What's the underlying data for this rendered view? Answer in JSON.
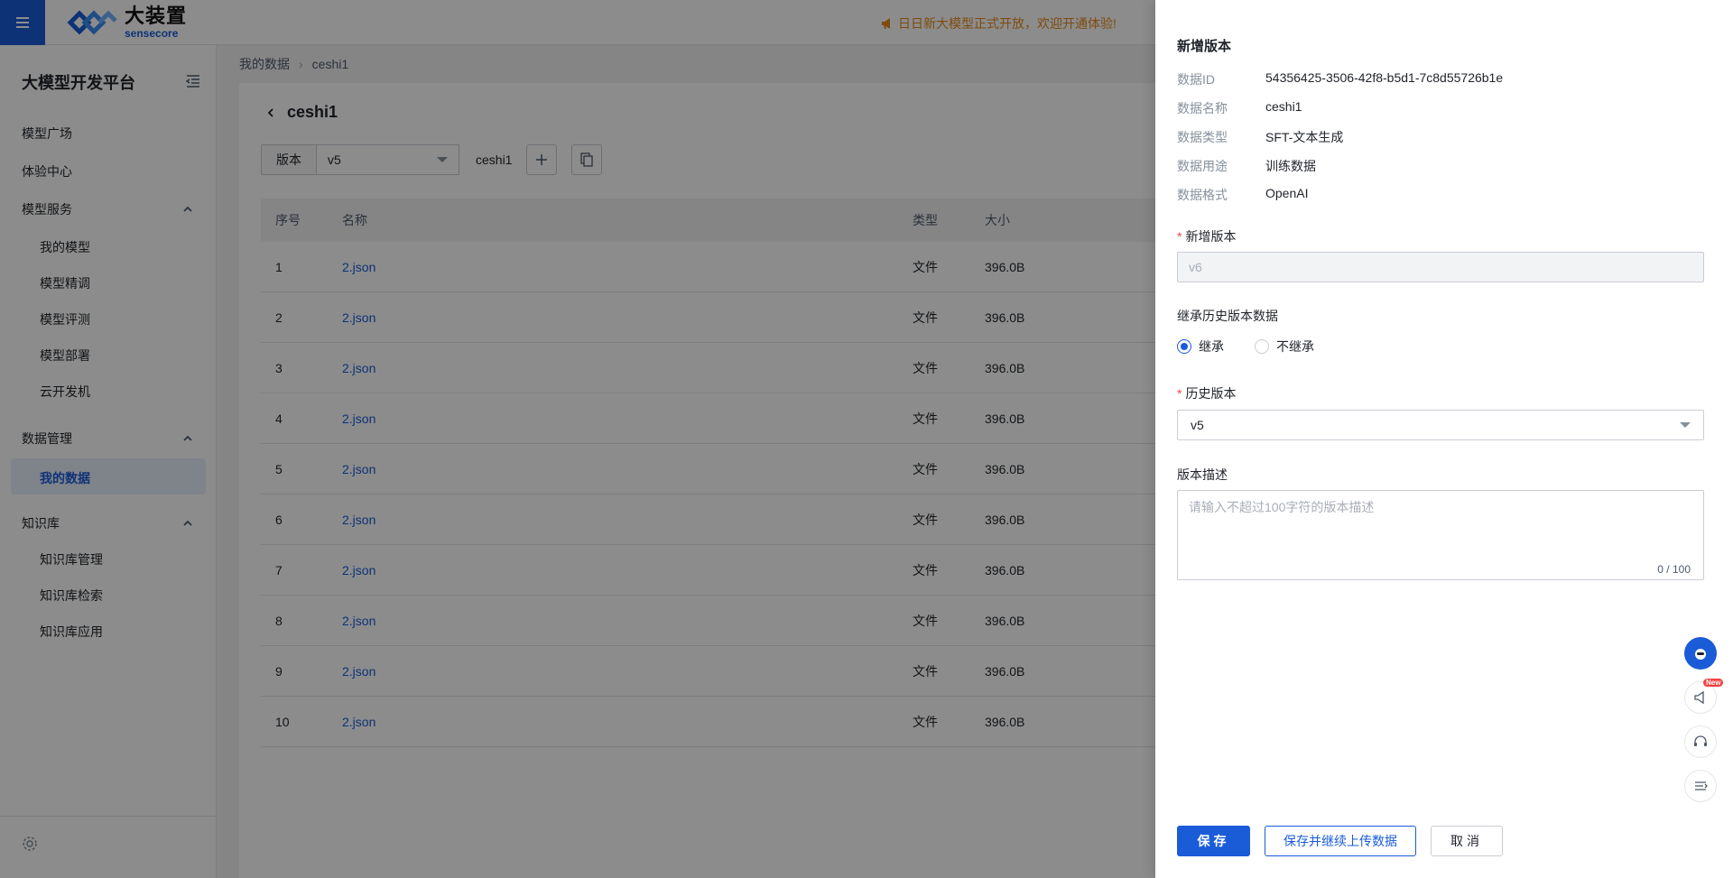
{
  "header": {
    "logo_cn": "大装置",
    "logo_en": "sensecore",
    "announcement": "日日新大模型正式开放，欢迎开通体验!"
  },
  "sidebar": {
    "title": "大模型开发平台",
    "items": {
      "square": "模型广场",
      "experience": "体验中心",
      "model_service": "模型服务",
      "my_models": "我的模型",
      "finetune": "模型精调",
      "evaluate": "模型评测",
      "deploy": "模型部署",
      "cloud_dev": "云开发机",
      "data_mgmt": "数据管理",
      "my_data": "我的数据",
      "kb": "知识库",
      "kb_mgmt": "知识库管理",
      "kb_search": "知识库检索",
      "kb_app": "知识库应用"
    }
  },
  "breadcrumb": {
    "root": "我的数据",
    "current": "ceshi1"
  },
  "page": {
    "title": "ceshi1",
    "version_label": "版本",
    "version_value": "v5",
    "dataset_name": "ceshi1"
  },
  "table": {
    "headers": {
      "idx": "序号",
      "name": "名称",
      "type": "类型",
      "size": "大小"
    },
    "rows": [
      {
        "idx": "1",
        "name": "2.json",
        "type": "文件",
        "size": "396.0B"
      },
      {
        "idx": "2",
        "name": "2.json",
        "type": "文件",
        "size": "396.0B"
      },
      {
        "idx": "3",
        "name": "2.json",
        "type": "文件",
        "size": "396.0B"
      },
      {
        "idx": "4",
        "name": "2.json",
        "type": "文件",
        "size": "396.0B"
      },
      {
        "idx": "5",
        "name": "2.json",
        "type": "文件",
        "size": "396.0B"
      },
      {
        "idx": "6",
        "name": "2.json",
        "type": "文件",
        "size": "396.0B"
      },
      {
        "idx": "7",
        "name": "2.json",
        "type": "文件",
        "size": "396.0B"
      },
      {
        "idx": "8",
        "name": "2.json",
        "type": "文件",
        "size": "396.0B"
      },
      {
        "idx": "9",
        "name": "2.json",
        "type": "文件",
        "size": "396.0B"
      },
      {
        "idx": "10",
        "name": "2.json",
        "type": "文件",
        "size": "396.0B"
      }
    ]
  },
  "drawer": {
    "title": "新增版本",
    "info": [
      {
        "k": "数据ID",
        "v": "54356425-3506-42f8-b5d1-7c8d55726b1e"
      },
      {
        "k": "数据名称",
        "v": "ceshi1"
      },
      {
        "k": "数据类型",
        "v": "SFT-文本生成"
      },
      {
        "k": "数据用途",
        "v": "训练数据"
      },
      {
        "k": "数据格式",
        "v": "OpenAI"
      }
    ],
    "new_version_label": "新增版本",
    "new_version_value": "v6",
    "inherit_label": "继承历史版本数据",
    "inherit_yes": "继承",
    "inherit_no": "不继承",
    "history_label": "历史版本",
    "history_value": "v5",
    "desc_label": "版本描述",
    "desc_placeholder": "请输入不超过100字符的版本描述",
    "desc_count": "0 / 100",
    "save": "保存",
    "save_upload": "保存并继续上传数据",
    "cancel": "取消"
  },
  "colors": {
    "primary": "#1a5bd8",
    "warning": "#e8891a",
    "danger": "#f53f3f"
  }
}
